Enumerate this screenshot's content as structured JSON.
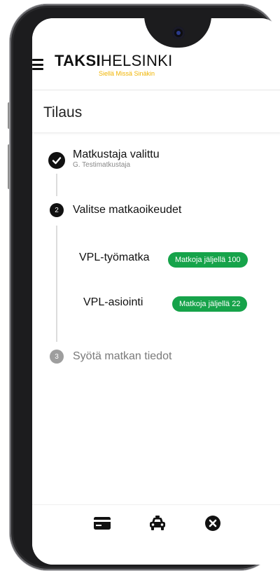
{
  "header": {
    "logo_bold": "TAKSI",
    "logo_rest": "HELSINKI",
    "logo_tagline": "Siellä Missä Sinäkin"
  },
  "page": {
    "title": "Tilaus"
  },
  "steps": [
    {
      "status": "done",
      "title": "Matkustaja valittu",
      "subtitle": "G. Testimatkustaja"
    },
    {
      "status": "active",
      "number": "2",
      "title": "Valitse matkaoikeudet"
    },
    {
      "status": "pending",
      "number": "3",
      "title": "Syötä matkan tiedot"
    }
  ],
  "options": [
    {
      "label": "VPL-työmatka",
      "badge": "Matkoja jäljellä 100"
    },
    {
      "label": "VPL-asiointi",
      "badge": "Matkoja jäljellä 22"
    }
  ],
  "bottom_bar": {
    "icons": [
      "credit-card-icon",
      "taxi-car-icon",
      "close-circle-icon"
    ]
  },
  "colors": {
    "brand_yellow": "#f0b400",
    "badge_green": "#16a34a",
    "active_step": "#111111",
    "inactive_step": "#9e9e9e"
  }
}
